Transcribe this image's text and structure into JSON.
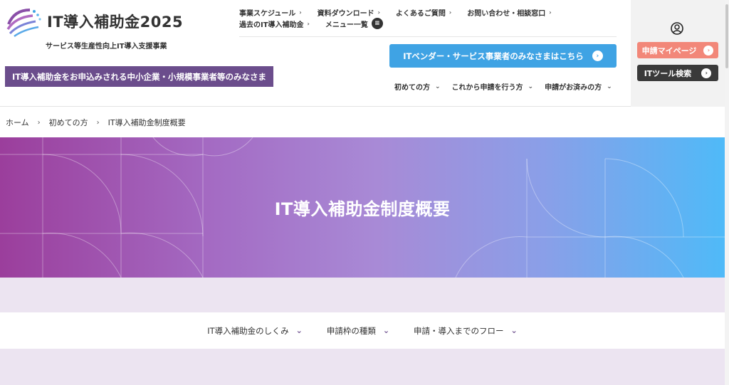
{
  "header": {
    "logo_text": "IT導入補助金2025",
    "tagline": "サービス等生産性向上IT導入支援事業",
    "sme_banner": "IT導入補助金をお申込みされる中小企業・小規模事業者等のみなさま",
    "top_links_row1": [
      {
        "label": "事業スケジュール"
      },
      {
        "label": "資料ダウンロード"
      },
      {
        "label": "よくあるご質問"
      },
      {
        "label": "お問い合わせ・相談窓口"
      }
    ],
    "top_links_row2": [
      {
        "label": "過去のIT導入補助金"
      }
    ],
    "menu_label": "メニュー一覧",
    "vendor_button": "ITベンダー・サービス事業者のみなさまはこちら",
    "subnav": [
      {
        "label": "初めての方"
      },
      {
        "label": "これから申請を行う方"
      },
      {
        "label": "申請がお済みの方"
      }
    ],
    "mypage_button": "申請マイページ",
    "tool_search_button": "ITツール検索"
  },
  "breadcrumb": [
    "ホーム",
    "初めての方",
    "IT導入補助金制度概要"
  ],
  "hero": {
    "title": "IT導入補助金制度概要"
  },
  "tabs": [
    {
      "label": "IT導入補助金のしくみ"
    },
    {
      "label": "申請枠の種類"
    },
    {
      "label": "申請・導入までのフロー"
    }
  ],
  "colors": {
    "brand_purple": "#6b4d8c",
    "vendor_blue": "#3fa3e4",
    "mypage_coral": "#f28779",
    "dark_button": "#3a3a3a",
    "lavender_bg": "#ece4f1"
  },
  "icons": {
    "chevron_right": "›",
    "chevron_down": "⌄",
    "menu": "≡",
    "arrow_circle": "›"
  }
}
